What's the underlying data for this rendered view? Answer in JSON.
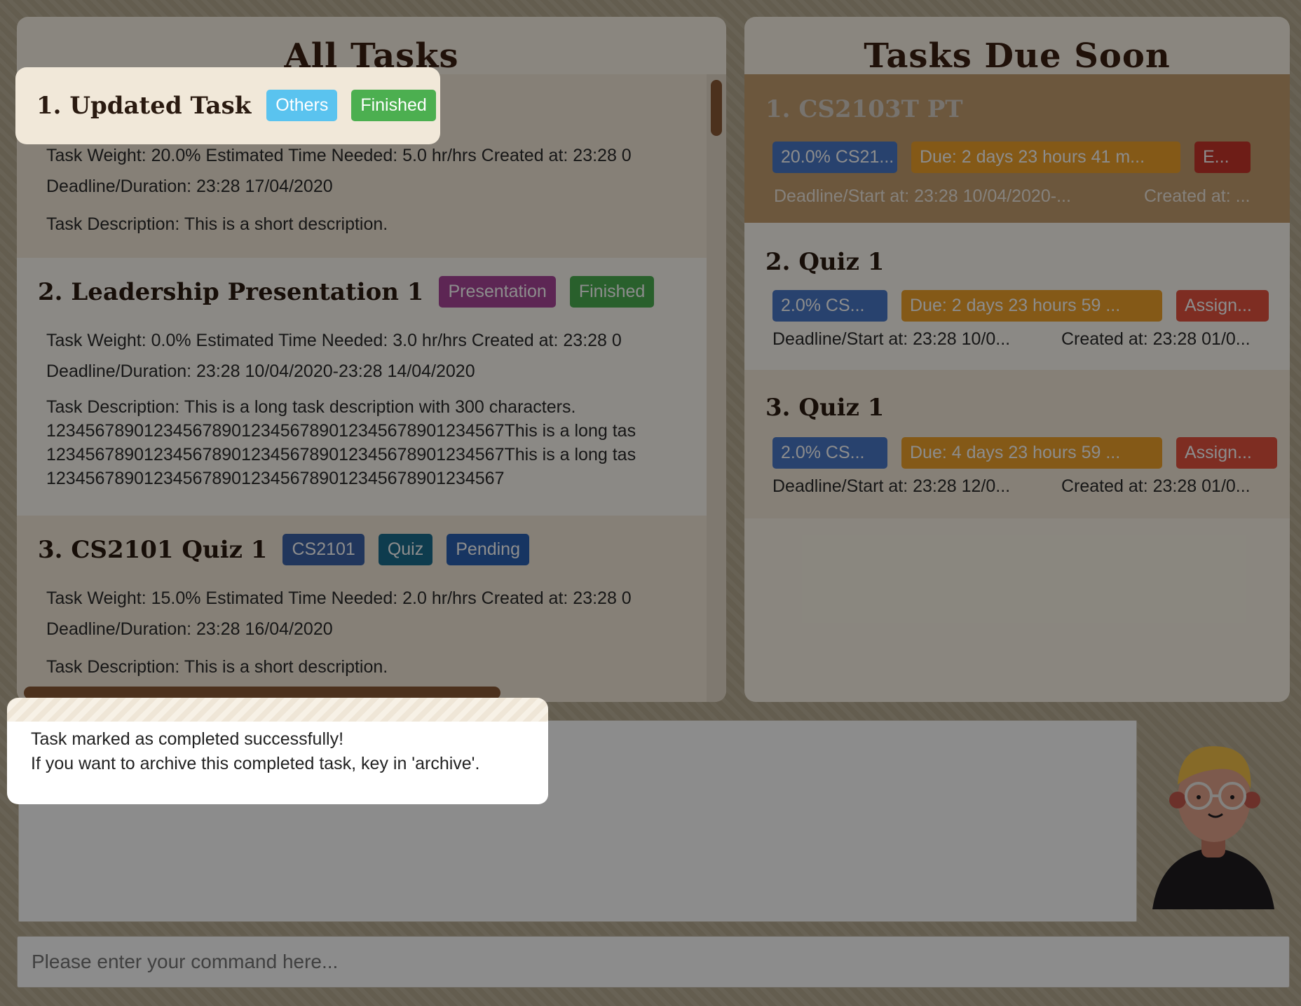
{
  "all_tasks": {
    "title": "All Tasks",
    "cards": [
      {
        "title": "1.  Updated Task",
        "tags": [
          {
            "label": "Others",
            "color": "#5ac3ef"
          },
          {
            "label": "Finished",
            "color": "#4caf50"
          }
        ],
        "weight_line": "Task Weight: 20.0%   Estimated Time Needed: 5.0 hr/hrs   Created at: 23:28 0",
        "deadline_line": "Deadline/Duration: 23:28 17/04/2020",
        "description": "Task Description: This is a short description."
      },
      {
        "title": "2.  Leadership Presentation 1",
        "tags": [
          {
            "label": "Presentation",
            "color": "#a9469a"
          },
          {
            "label": "Finished",
            "color": "#4caf50"
          }
        ],
        "weight_line": "Task Weight: 0.0%   Estimated Time Needed: 3.0 hr/hrs   Created at: 23:28 0",
        "deadline_line": "Deadline/Duration: 23:28 10/04/2020-23:28 14/04/2020",
        "description": "Task Description: This is a long task description with 300 characters.\n1234567890123456789012345678901234567890123456​7This is a long tas\n1234567890123456789012345678901234567890123456​7This is a long tas\n12345678901234567890123456789012345678901234567"
      },
      {
        "title": "3.  CS2101 Quiz 1",
        "tags": [
          {
            "label": "CS2101",
            "color": "#3d63a8"
          },
          {
            "label": "Quiz",
            "color": "#1a6e8e"
          },
          {
            "label": "Pending",
            "color": "#2b62b3"
          }
        ],
        "weight_line": "Task Weight: 15.0%   Estimated Time Needed: 2.0 hr/hrs   Created at: 23:28 0",
        "deadline_line": "Deadline/Duration: 23:28 16/04/2020",
        "description": "Task Description: This is a short description."
      }
    ]
  },
  "due_soon": {
    "title": "Tasks Due Soon",
    "cards": [
      {
        "title": "1.  CS2103T PT",
        "pills": [
          {
            "label": "20.0% CS21...",
            "color": "#4a78c9"
          },
          {
            "label": "Due: 2 days 23 hours 41 m...",
            "color": "#f0a32a"
          },
          {
            "label": "E...",
            "color": "#c8362b"
          }
        ],
        "deadline": "Deadline/Start at: 23:28 10/04/2020-...",
        "created": "Created at: ..."
      },
      {
        "title": "2.  Quiz 1",
        "pills": [
          {
            "label": "2.0% CS...",
            "color": "#4a78c9"
          },
          {
            "label": "Due: 2 days 23 hours 59 ...",
            "color": "#f0a32a"
          },
          {
            "label": "Assign...",
            "color": "#e5533f"
          }
        ],
        "deadline": "Deadline/Start at: 23:28 10/0...",
        "created": "Created at: 23:28 01/0..."
      },
      {
        "title": "3.  Quiz 1",
        "pills": [
          {
            "label": "2.0% CS...",
            "color": "#4a78c9"
          },
          {
            "label": "Due: 4 days 23 hours 59 ...",
            "color": "#f0a32a"
          },
          {
            "label": "Assign...",
            "color": "#e5533f"
          }
        ],
        "deadline": "Deadline/Start at: 23:28 12/0...",
        "created": "Created at: 23:28 01/0..."
      }
    ]
  },
  "result": {
    "line1": "Task marked as completed successfully!",
    "line2": "If you want to archive this completed task, key in 'archive'."
  },
  "command": {
    "placeholder": "Please enter your command here..."
  },
  "colors": {
    "title_brown": "#3b1f12",
    "panel_bg": "#fbf5e8",
    "scroll_thumb": "#8a5a36"
  }
}
